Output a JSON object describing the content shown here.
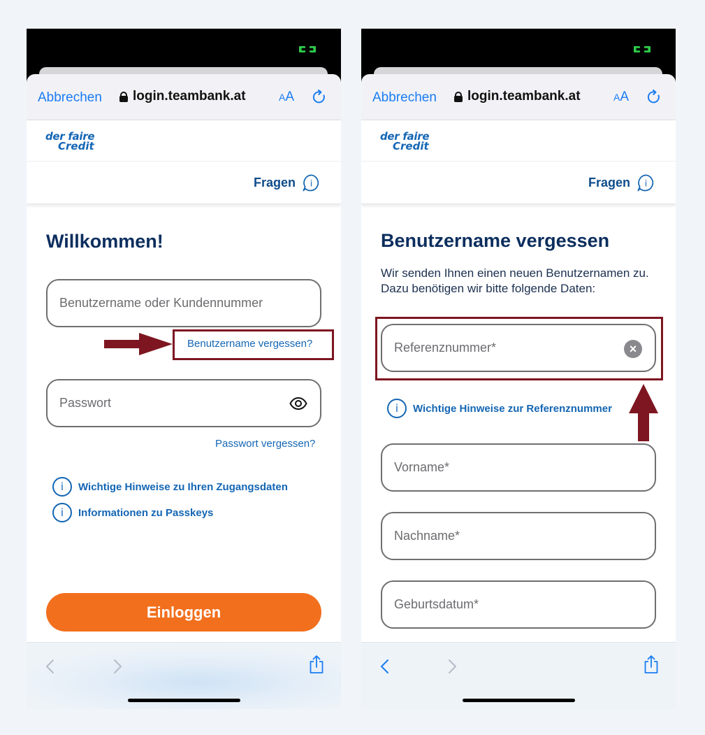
{
  "left": {
    "browser": {
      "cancel": "Abbrechen",
      "url": "login.teambank.at",
      "text_size": "AA"
    },
    "logo": {
      "line1": "der faire",
      "line2": "Credit"
    },
    "topbar": {
      "help": "Fragen"
    },
    "heading": "Willkommen!",
    "username_placeholder": "Benutzername oder Kundennummer",
    "forgot_username": "Benutzername vergessen?",
    "password_placeholder": "Passwort",
    "forgot_password": "Passwort vergessen?",
    "info1": "Wichtige Hinweise zu Ihren Zugangsdaten",
    "info2": "Informationen zu Passkeys",
    "login_button": "Einloggen"
  },
  "right": {
    "browser": {
      "cancel": "Abbrechen",
      "url": "login.teambank.at",
      "text_size": "AA"
    },
    "logo": {
      "line1": "der faire",
      "line2": "Credit"
    },
    "topbar": {
      "help": "Fragen"
    },
    "heading": "Benutzername vergessen",
    "description": "Wir senden Ihnen einen neuen Benutzernamen zu. Dazu benötigen wir bitte folgende Daten:",
    "reference_placeholder": "Referenznummer*",
    "reference_info": "Wichtige Hinweise zur Referenznummer",
    "firstname_placeholder": "Vorname*",
    "lastname_placeholder": "Nachname*",
    "birthdate_placeholder": "Geburtsdatum*"
  },
  "icons": {
    "info": "info-icon",
    "help": "help-bubble-icon",
    "eye": "eye-icon",
    "clear": "clear-icon",
    "lock": "lock-icon",
    "reload": "reload-icon",
    "share": "share-icon"
  },
  "colors": {
    "brand_blue": "#1466b4",
    "heading_navy": "#0c2e5e",
    "accent_orange": "#f26f1d",
    "ios_blue": "#1a7cf2",
    "annotation_red": "#7d1620"
  }
}
